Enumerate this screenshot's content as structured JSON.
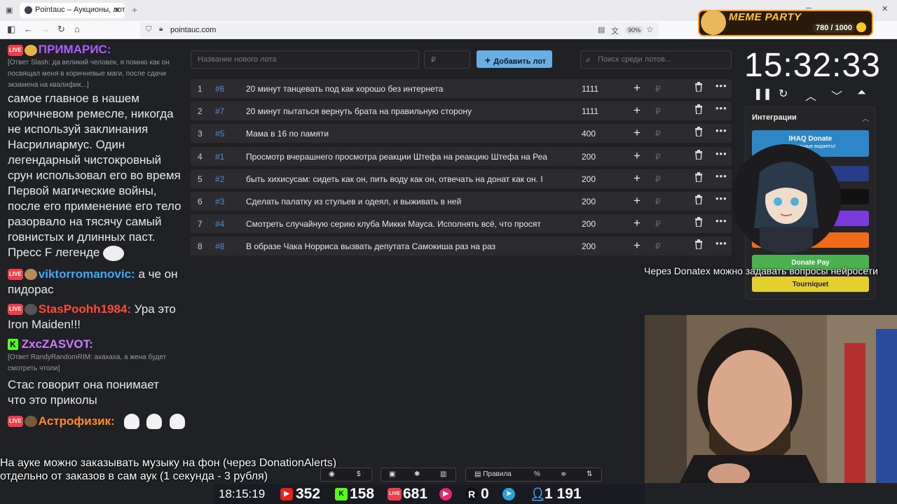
{
  "browser": {
    "tab_title": "Pointauc – Аукционы, лотереи",
    "url": "pointauc.com",
    "zoom": "90%"
  },
  "auction": {
    "lot_name_placeholder": "Название нового лота",
    "amount_placeholder": "₽",
    "add_button": "Добавить лот",
    "search_placeholder": "Поиск среди лотов...",
    "currency": "₽",
    "lots": [
      {
        "index": "1",
        "id": "#6",
        "name": "20 минут танцевать под как хорошо без интернета",
        "amount": "1111"
      },
      {
        "index": "2",
        "id": "#7",
        "name": "20 минут пытаться вернуть брата на правильную сторону",
        "amount": "1111"
      },
      {
        "index": "3",
        "id": "#5",
        "name": "Мама в 16 по памяти",
        "amount": "400"
      },
      {
        "index": "4",
        "id": "#1",
        "name": "Просмотр вчерашнего просмотра реакции Штефа на реакцию Штефа на Реа",
        "amount": "200"
      },
      {
        "index": "5",
        "id": "#2",
        "name": "быть хихисусам: сидеть как он, пить воду как он, отвечать на донат как он. I",
        "amount": "200"
      },
      {
        "index": "6",
        "id": "#3",
        "name": "Сделать палатку из стульев и одеял, и выживать в ней",
        "amount": "200"
      },
      {
        "index": "7",
        "id": "#4",
        "name": "Смотреть случайную серию клуба Микки Мауса. Исполнять всё, что просят",
        "amount": "200"
      },
      {
        "index": "8",
        "id": "#8",
        "name": "В образе Чака Норриса вызвать депутата Самокиша раз на раз",
        "amount": "200"
      }
    ]
  },
  "timer": {
    "time": "15:32:33",
    "controls": [
      "pause",
      "restart",
      "up",
      "down",
      "collapse"
    ]
  },
  "integrations": {
    "title": "Интеграции",
    "items": [
      {
        "label": "IHAQ Donate",
        "sub": "Уникальные виджеты!",
        "color": "#2d86c5"
      },
      {
        "label": "er",
        "color": "#283d8a"
      },
      {
        "label": "",
        "color": "#111111"
      },
      {
        "label": "",
        "color": "#7a3ad9"
      },
      {
        "label": "Alerts",
        "color": "#f16a1b"
      },
      {
        "label": "Donate Pay",
        "color": "#4cb050"
      },
      {
        "label": "Tourniquet",
        "color": "#e3d02f"
      }
    ]
  },
  "chat": {
    "messages": [
      {
        "badge": "LIVE",
        "nick": "ПРИМАРИС:",
        "nick_color": "#b15cff",
        "reply": "[Ответ Slash: да великий человек, я помню как он посвящал меня в коричневые маги, после сдачи экзамена на квалифик...]",
        "text": "самое главное в нашем коричневом ремесле, никогда не используй заклинания Насрилиармус. Один легендарный чистокровный срун использовал его во время Первой магические войны, после его применение его тело разорвало на тясячу самый говнистых и длинных паст. Пресс F легенде"
      },
      {
        "badge": "LIVE",
        "nick": "viktorromanovic:",
        "nick_color": "#3fa9f5",
        "text": "а че он пидорас"
      },
      {
        "badge": "LIVE",
        "nick": "StasPoohh1984:",
        "nick_color": "#ff4a3d",
        "text": "Ура это Iron Maiden!!!"
      },
      {
        "badge": "K",
        "nick": "ZxcZASVOT:",
        "nick_color": "#d27bff",
        "reply": "[Ответ RandyRandomRIM: ахахаха, а жена будет смотреть чтоли]",
        "text": "Стас говорит она понимает что это приколы"
      },
      {
        "badge": "LIVE",
        "nick": "Астрофизик:",
        "nick_color": "#ff8a2a",
        "text": ""
      }
    ]
  },
  "overlay": {
    "donatex_note": "Через Donatex можно задавать вопросы нейросети",
    "auk_note_line1": "На ауке можно заказывать музыку на фон (через DonationAlerts)",
    "auk_note_line2": "отдельно от заказов в сам аук (1 секунда - 3 рубля)",
    "meme_title": "MEME PARTY",
    "meme_count": "780 / 1000"
  },
  "bottom_toolbar": {
    "rules": "Правила"
  },
  "status": {
    "clock": "18:15:19",
    "youtube": "352",
    "kick": "158",
    "live": "681",
    "rutube": "0",
    "total": "1 191"
  }
}
